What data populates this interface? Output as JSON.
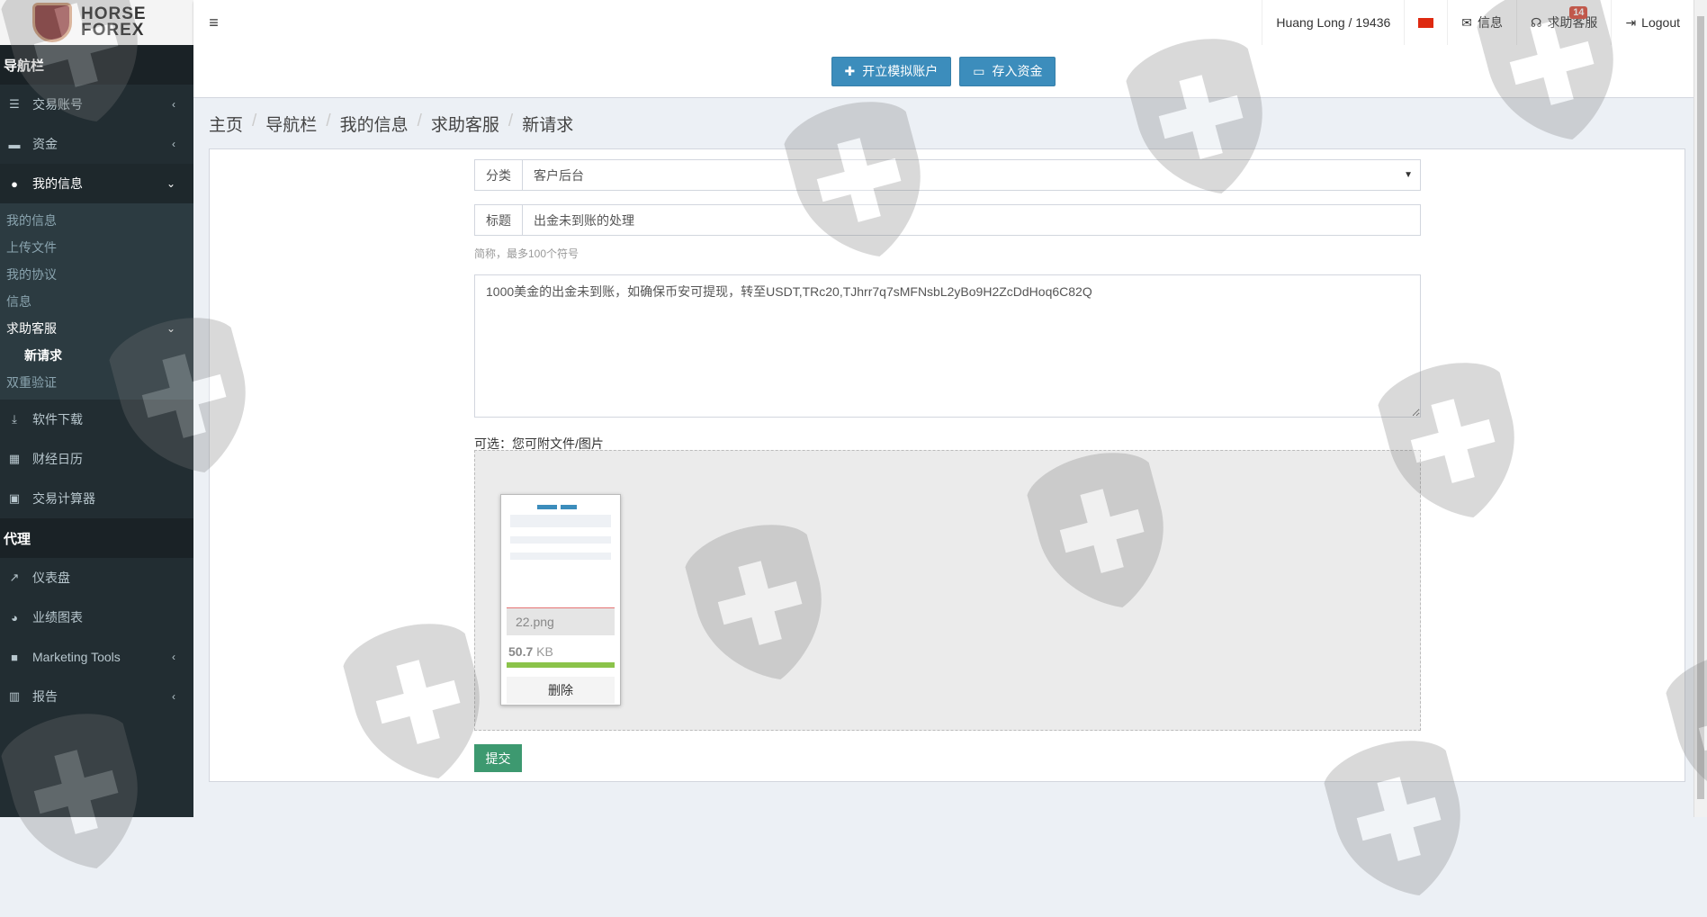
{
  "brand": {
    "line1": "HORSE",
    "line2": "FOREX"
  },
  "sidebar": {
    "header1": "导航栏",
    "items": [
      {
        "label": "交易账号",
        "icon": "list-icon"
      },
      {
        "label": "资金",
        "icon": "wallet-icon"
      },
      {
        "label": "我的信息",
        "icon": "user-icon"
      }
    ],
    "sub": [
      "我的信息",
      "上传文件",
      "我的协议",
      "信息",
      "求助客服",
      "新请求",
      "双重验证"
    ],
    "items2": [
      {
        "label": "软件下载",
        "icon": "download-icon"
      },
      {
        "label": "财经日历",
        "icon": "calendar-icon"
      },
      {
        "label": "交易计算器",
        "icon": "calculator-icon"
      }
    ],
    "header2": "代理",
    "items3": [
      {
        "label": "仪表盘",
        "icon": "line-chart-icon"
      },
      {
        "label": "业绩图表",
        "icon": "pie-chart-icon"
      },
      {
        "label": "Marketing Tools",
        "icon": "briefcase-icon"
      },
      {
        "label": "报告",
        "icon": "bar-chart-icon"
      }
    ]
  },
  "topbar": {
    "user": "Huang Long / 19436",
    "messages": "信息",
    "support": "求助客服",
    "support_badge": "14",
    "logout": "Logout"
  },
  "actions": {
    "demo": "开立模拟账户",
    "deposit": "存入资金"
  },
  "breadcrumb": [
    "主页",
    "导航栏",
    "我的信息",
    "求助客服",
    "新请求"
  ],
  "form": {
    "category_label": "分类",
    "category_value": "客户后台",
    "title_label": "标题",
    "title_value": "出金未到账的处理",
    "title_hint": "简称，最多100个符号",
    "message": "1000美金的出金未到账，如确保币安可提现，转至USDT,TRc20,TJhrr7q7sMFNsbL2yBo9H2ZcDdHoq6C82Q",
    "attach_label": "可选：您可附文件/图片",
    "file": {
      "name": "22.png",
      "size_num": "50.7",
      "size_unit": "KB",
      "progress": 100,
      "remove": "删除"
    },
    "submit": "提交"
  }
}
